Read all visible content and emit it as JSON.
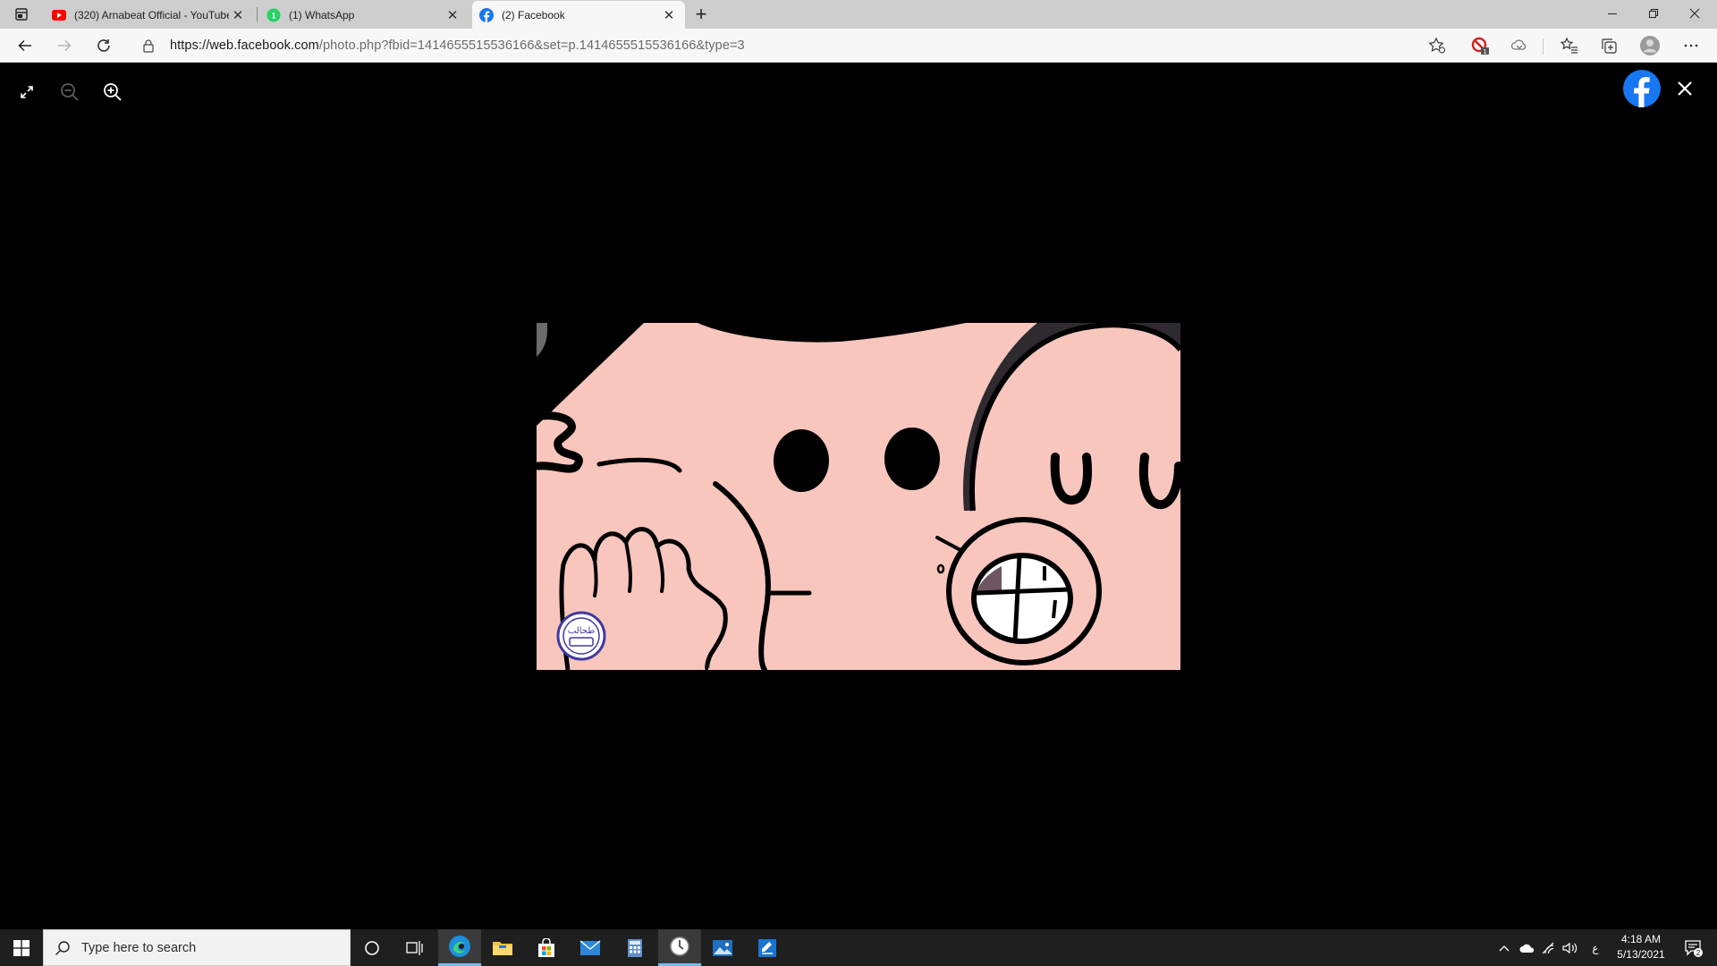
{
  "browser": {
    "tabs": [
      {
        "title": "(320) Arnabeat Official - YouTube",
        "favicon": "youtube-icon",
        "active": false
      },
      {
        "title": "(1) WhatsApp",
        "favicon": "whatsapp-icon",
        "active": false
      },
      {
        "title": "(2) Facebook",
        "favicon": "facebook-icon",
        "active": true
      }
    ],
    "url_host": "https://web.facebook.com",
    "url_path": "/photo.php?fbid=1414655515536166&set=p.1414655515536166&type=3",
    "close_glyph": "✕",
    "newtab_glyph": "+"
  },
  "viewer": {
    "tools": [
      "exit-fullscreen-icon",
      "zoom-out-icon",
      "zoom-in-icon"
    ],
    "logo": "facebook-logo",
    "close_glyph": "✕",
    "photo_stamp": "طحالب"
  },
  "taskbar": {
    "search_placeholder": "Type here to search",
    "time": "4:18 AM",
    "date": "5/13/2021",
    "lang": "ع",
    "notification_count": "2"
  },
  "colors": {
    "accent": "#1877f2",
    "photo_skin": "#f8c6bd",
    "hair": "#2e2a2f"
  }
}
